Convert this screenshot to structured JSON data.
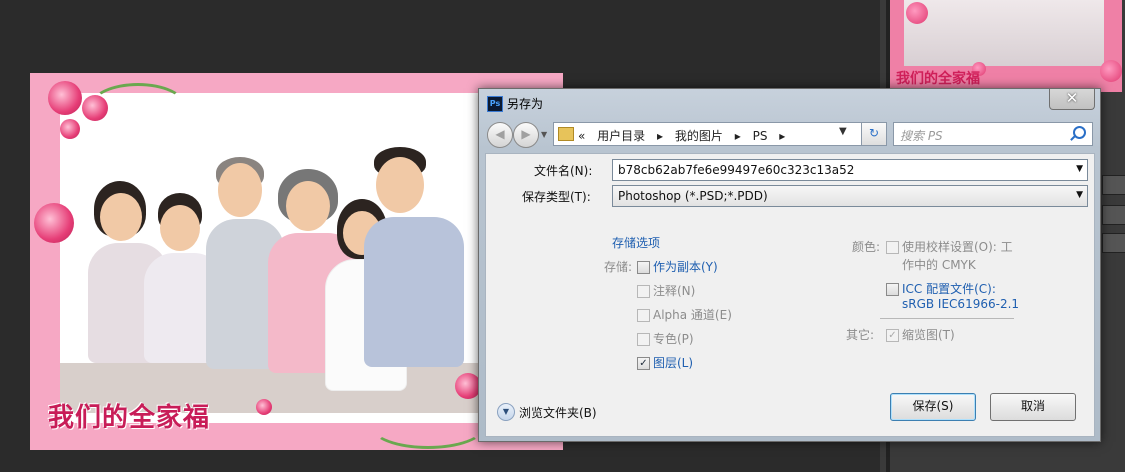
{
  "canvas": {
    "banner_text": "我们的全家福"
  },
  "navigator_thumb": {
    "banner_text": "我们的全家福"
  },
  "dialog": {
    "title": "另存为",
    "app_icon_text": "Ps",
    "close_symbol": "✕",
    "nav": {
      "back_symbol": "◀",
      "forward_symbol": "▶",
      "breadcrumbs": [
        "«",
        "用户目录",
        "▸",
        "我的图片",
        "▸",
        "PS",
        "▸"
      ],
      "search_placeholder": "搜索 PS",
      "refresh_symbol": "↻"
    },
    "filename": {
      "label": "文件名(N):",
      "value": "b78cb62ab7fe6e99497e60c323c13a52"
    },
    "filetype": {
      "label": "保存类型(T):",
      "value": "Photoshop (*.PSD;*.PDD)"
    },
    "save_options": {
      "heading": "存储选项",
      "save_label": "存储:",
      "items": [
        {
          "label": "作为副本(Y)",
          "checked": false,
          "enabled": true
        },
        {
          "label": "注释(N)",
          "checked": false,
          "enabled": false
        },
        {
          "label": "Alpha 通道(E)",
          "checked": false,
          "enabled": false
        },
        {
          "label": "专色(P)",
          "checked": false,
          "enabled": false
        },
        {
          "label": "图层(L)",
          "checked": true,
          "enabled": true
        }
      ]
    },
    "color": {
      "label": "颜色:",
      "proof_line1": "使用校样设置(O):  工",
      "proof_line2": "作中的 CMYK",
      "icc_label": "ICC 配置文件(C):",
      "icc_value": "sRGB IEC61966-2.1"
    },
    "other": {
      "label": "其它:",
      "thumbnail_label": "缩览图(T)",
      "thumbnail_checked": true
    },
    "browse_folders": "浏览文件夹(B)",
    "save_button": "保存(S)",
    "cancel_button": "取消"
  },
  "colors": {
    "canvas_border": "#f6a8c4",
    "banner": "#c81d58",
    "dialog_frame": "#b8c4d0",
    "link_blue": "#1f5fb0"
  }
}
